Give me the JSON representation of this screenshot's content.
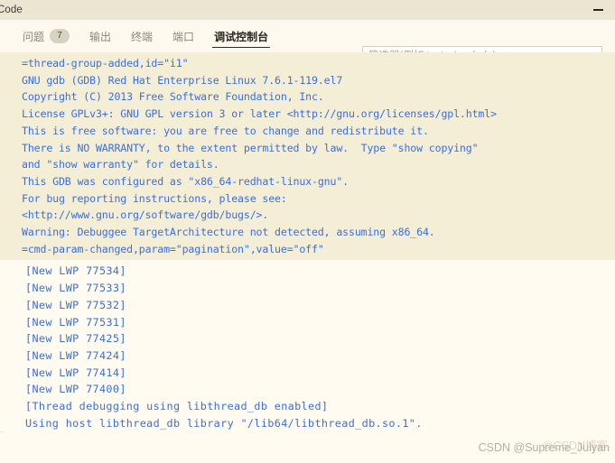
{
  "window": {
    "title": "Code",
    "minimize_label": "−"
  },
  "panel": {
    "tabs": [
      {
        "label": "问题",
        "badge": "7",
        "active": false
      },
      {
        "label": "输出",
        "badge": null,
        "active": false
      },
      {
        "label": "终端",
        "badge": null,
        "active": false
      },
      {
        "label": "端口",
        "badge": null,
        "active": false
      },
      {
        "label": "调试控制台",
        "badge": null,
        "active": true
      }
    ],
    "filter": {
      "value": "",
      "placeholder": "筛选器(例如 text、!exclude)"
    }
  },
  "console": {
    "text_color": "#3a6fe0",
    "gdb_block_bg": "#f5eed6",
    "thread_block_bg": "#fffbf0",
    "gdb_lines": [
      "=thread-group-added,id=\"i1\"",
      "GNU gdb (GDB) Red Hat Enterprise Linux 7.6.1-119.el7",
      "Copyright (C) 2013 Free Software Foundation, Inc.",
      "License GPLv3+: GNU GPL version 3 or later <http://gnu.org/licenses/gpl.html>",
      "This is free software: you are free to change and redistribute it.",
      "There is NO WARRANTY, to the extent permitted by law.  Type \"show copying\"",
      "and \"show warranty\" for details.",
      "This GDB was configured as \"x86_64-redhat-linux-gnu\".",
      "For bug reporting instructions, please see:",
      "<http://www.gnu.org/software/gdb/bugs/>.",
      "Warning: Debuggee TargetArchitecture not detected, assuming x86_64.",
      "=cmd-param-changed,param=\"pagination\",value=\"off\""
    ],
    "thread_lines": [
      "[New LWP 77534]",
      "[New LWP 77533]",
      "[New LWP 77532]",
      "[New LWP 77531]",
      "[New LWP 77425]",
      "[New LWP 77424]",
      "[New LWP 77414]",
      "[New LWP 77400]",
      "[Thread debugging using libthread_db enabled]",
      "Using host libthread_db library \"/lib64/libthread_db.so.1\"."
    ]
  },
  "watermark": {
    "text": "CSDN @Supreme_Julyan",
    "ghost_text": "@CSDN博客"
  }
}
